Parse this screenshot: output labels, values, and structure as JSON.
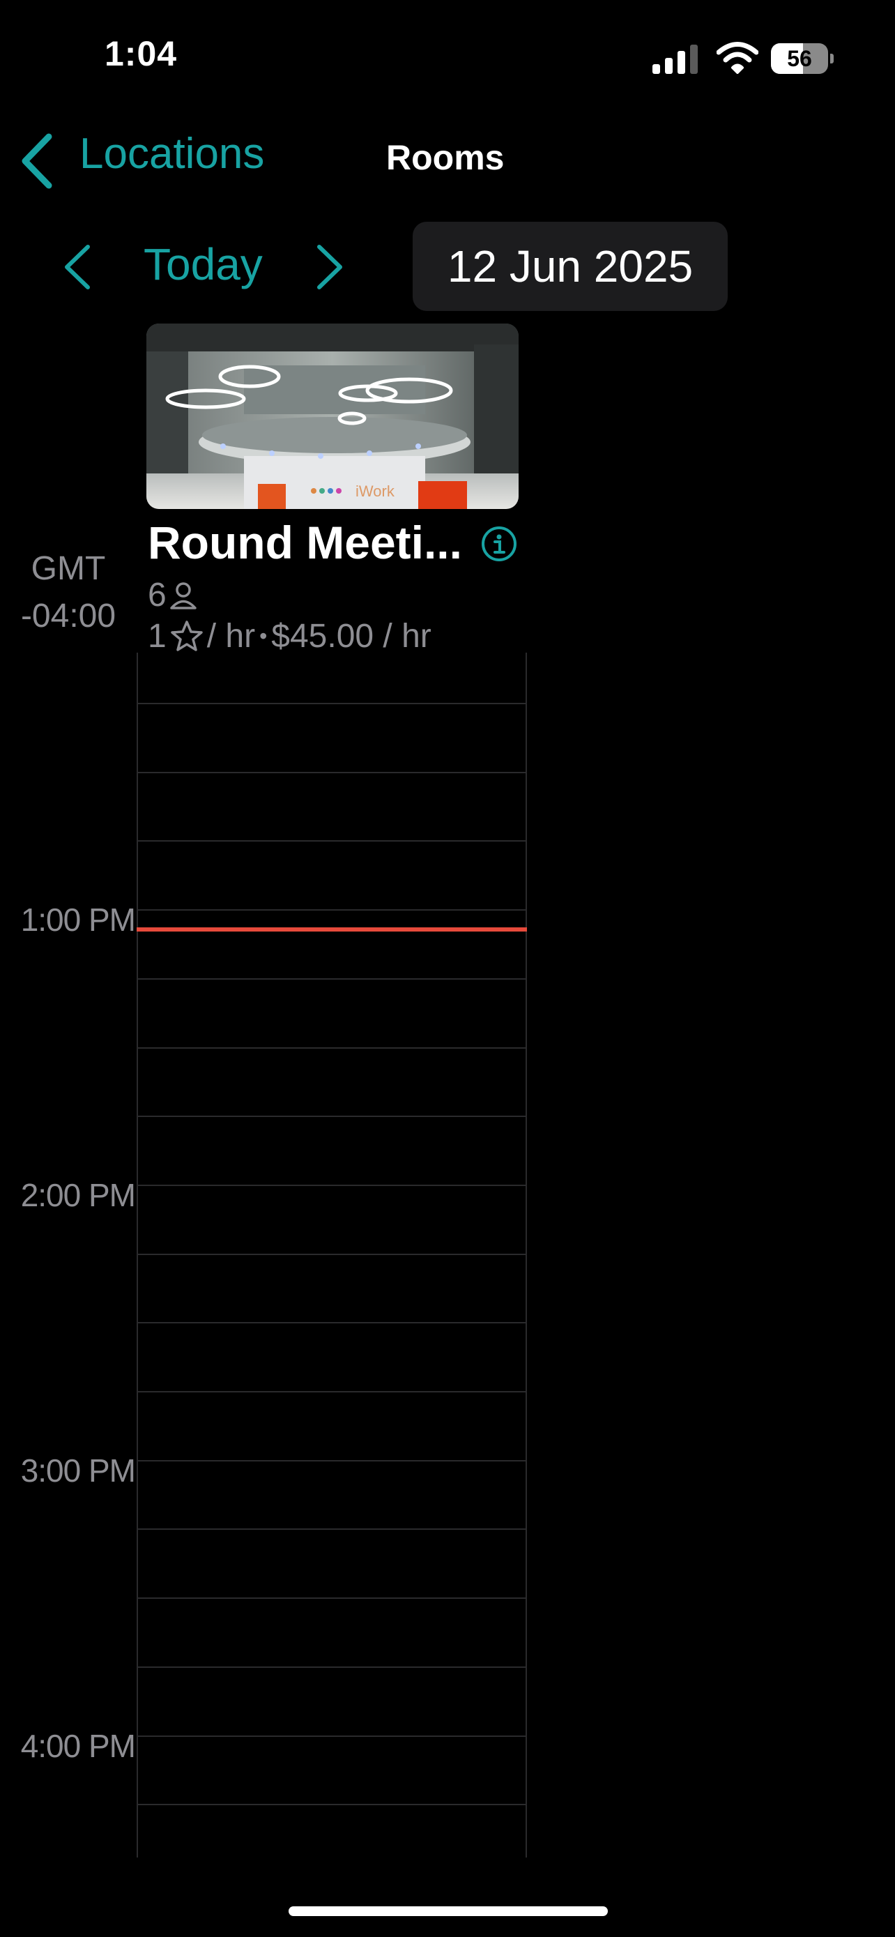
{
  "status_bar": {
    "time": "1:04",
    "battery": "56",
    "battery_level": 56
  },
  "nav": {
    "back_label": "Locations",
    "title": "Rooms"
  },
  "date_bar": {
    "today_label": "Today",
    "date": "12 Jun 2025"
  },
  "room": {
    "name": "Round Meeti...",
    "capacity": "6",
    "credits": "1",
    "credit_unit": "/ hr",
    "separator": "•",
    "price": "$45.00 / hr"
  },
  "timezone": {
    "line1": "GMT",
    "line2": "-04:00"
  },
  "time_labels": [
    "1:00 PM",
    "2:00 PM",
    "3:00 PM",
    "4:00 PM"
  ],
  "colors": {
    "accent": "#18a3a3",
    "now_line": "#e64a3b",
    "background": "#000000",
    "pill": "#1c1c1e"
  },
  "icons": [
    "back-chevron-icon",
    "prev-day-icon",
    "next-day-icon",
    "info-icon",
    "person-icon",
    "star-icon",
    "signal-icon",
    "wifi-icon",
    "battery-icon"
  ]
}
